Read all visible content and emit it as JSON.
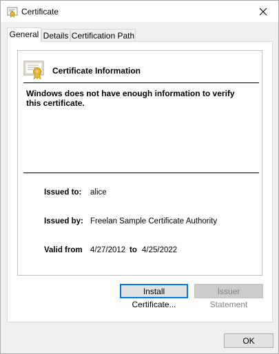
{
  "window": {
    "title": "Certificate",
    "icon": "certificate-icon",
    "close_icon": "close-icon"
  },
  "tabs": [
    {
      "label": "General",
      "active": true
    },
    {
      "label": "Details",
      "active": false
    },
    {
      "label": "Certification Path",
      "active": false
    }
  ],
  "info": {
    "title": "Certificate Information",
    "warning": "Windows does not have enough information to verify this certificate.",
    "issued_to_label": "Issued to:",
    "issued_to_value": "alice",
    "issued_by_label": "Issued by:",
    "issued_by_value": "Freelan Sample Certificate Authority",
    "valid_from_label": "Valid from",
    "valid_from_value": "4/27/2012",
    "to_label": "to",
    "valid_to_value": "4/25/2022"
  },
  "buttons": {
    "install": "Install Certificate...",
    "issuer_statement": "Issuer Statement",
    "ok": "OK"
  },
  "colors": {
    "accent": "#0078d7",
    "cert_gold": "#e8b830"
  }
}
